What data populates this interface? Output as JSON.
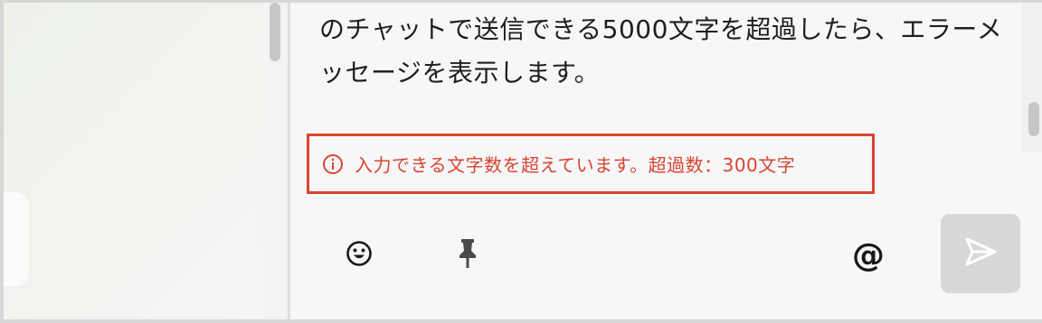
{
  "message": {
    "text": "のチャットで送信できる5000文字を超過したら、エラーメッセージを表示します。"
  },
  "error": {
    "icon": "info-circle-icon",
    "text": "入力できる文字数を超えています。超過数：300文字",
    "color": "#d9452f"
  },
  "toolbar": {
    "emoji_icon": "smiley-icon",
    "pin_icon": "pin-icon",
    "mention_label": "@",
    "send_icon": "send-icon"
  },
  "colors": {
    "error": "#d9452f",
    "send_button_disabled": "#d8d8da",
    "chat_background": "#f7f7f9"
  }
}
